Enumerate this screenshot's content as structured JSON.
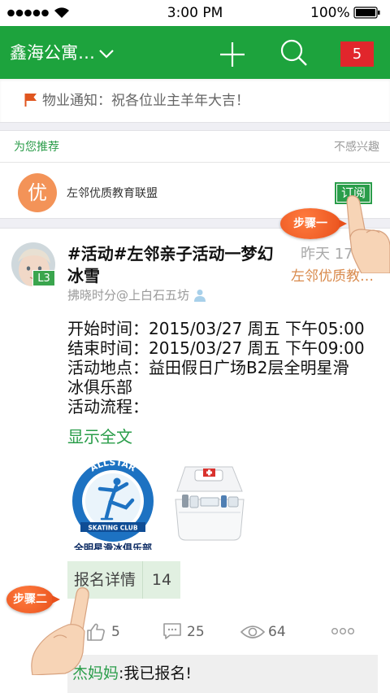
{
  "status_bar": {
    "time": "3:00 PM",
    "battery": "100%"
  },
  "header": {
    "title": "鑫海公寓…",
    "badge_count": "5"
  },
  "notice": {
    "text": "物业通知：祝各位业主羊年大吉！"
  },
  "recommend": {
    "heading": "为您推荐",
    "dismiss": "不感兴趣",
    "item": {
      "avatar_char": "优",
      "name": "左邻优质教育联盟",
      "subscribe_label": "订阅"
    }
  },
  "tutorial": {
    "step1": "步骤一",
    "step2": "步骤二"
  },
  "post": {
    "level": "L3",
    "title": "#活动#左邻亲子活动一梦幻冰雪",
    "time": "昨天 17",
    "group": "左邻优质教…",
    "author": "拂晓时分@上白石五坊",
    "body": [
      "开始时间：2015/03/27 周五 下午05:00",
      "结束时间：2015/03/27 周五 下午09:00",
      "活动地点：益田假日广场B2层全明星滑冰俱乐部",
      "活动流程："
    ],
    "show_full": "显示全文",
    "images": [
      {
        "kind": "logo",
        "logo_top": "ALLSTAR",
        "logo_band": "SKATING CLUB",
        "logo_bottom": "全明星滑冰俱乐部"
      },
      {
        "kind": "first-aid-box"
      }
    ],
    "signup": {
      "label": "报名详情",
      "count": "14"
    },
    "actions": {
      "likes": "5",
      "comments": "25",
      "views": "64"
    },
    "comment": {
      "author": "杰妈妈",
      "text": ":我已报名!"
    }
  },
  "icons": {
    "header": [
      "chevron-down-icon",
      "plus-icon",
      "search-icon"
    ],
    "notice": "flag-icon",
    "author": "person-icon",
    "actions": [
      "thumbs-up-icon",
      "comment-icon",
      "eye-icon",
      "more-icon"
    ]
  },
  "colors": {
    "brand_green": "#1da33d",
    "link_green": "#2a9d4a",
    "badge_red": "#e1262c",
    "callout_orange": "#e8501c",
    "group_orange": "#d98a4c",
    "avatar_orange": "#f39358"
  }
}
